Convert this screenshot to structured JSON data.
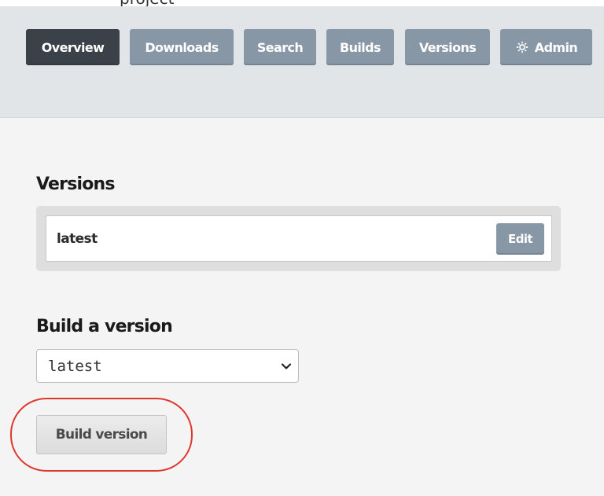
{
  "top_strip": {
    "cut_text": "project"
  },
  "nav": {
    "tabs": [
      {
        "label": "Overview",
        "active": true
      },
      {
        "label": "Downloads",
        "active": false
      },
      {
        "label": "Search",
        "active": false
      },
      {
        "label": "Builds",
        "active": false
      },
      {
        "label": "Versions",
        "active": false
      },
      {
        "label": "Admin",
        "active": false,
        "icon": "gear-icon"
      }
    ]
  },
  "versions_section": {
    "title": "Versions",
    "items": [
      {
        "name": "latest",
        "edit_label": "Edit"
      }
    ]
  },
  "build_section": {
    "title": "Build a version",
    "select_value": "latest",
    "build_button_label": "Build version"
  },
  "annotation": {
    "highlight_color": "#e0352b"
  },
  "colors": {
    "tab_active": "#3a4148",
    "tab_inactive": "#8797a5",
    "header_bg": "#e2e5e8",
    "page_bg": "#f4f4f4"
  }
}
